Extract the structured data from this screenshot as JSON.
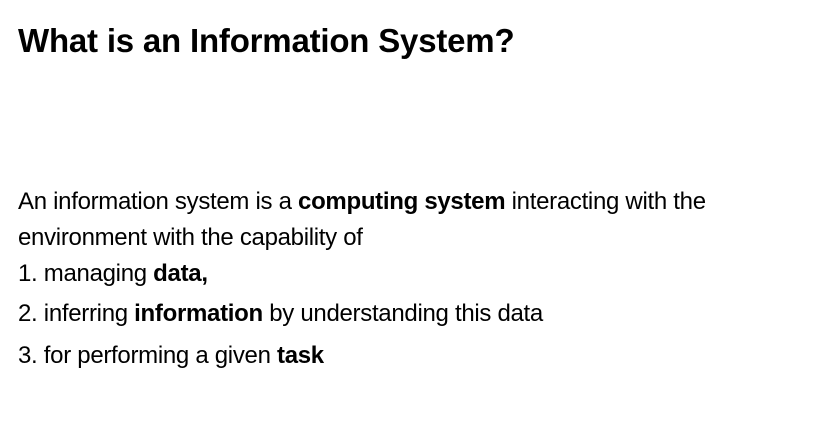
{
  "slide": {
    "title": "What is an Information System?",
    "intro": {
      "before": "An information system is a ",
      "bold": "computing system",
      "after": " interacting with the environment with the capability of"
    },
    "list": [
      {
        "number": "1.",
        "before": " managing ",
        "bold": "data,",
        "after": ""
      },
      {
        "number": "2.",
        "before": " inferring ",
        "bold": "information",
        "after": " by understanding this data"
      },
      {
        "number": "3.",
        "before": " for performing a given ",
        "bold": "task",
        "after": ""
      }
    ]
  }
}
